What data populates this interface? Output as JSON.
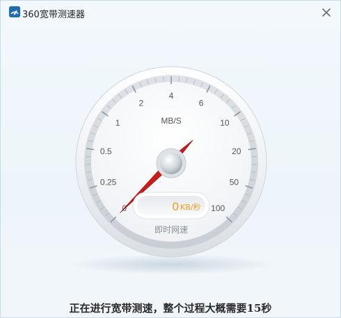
{
  "window": {
    "title": "360宽带测速器",
    "close_icon": "close-icon",
    "app_icon": "360-broadband-speedtest-icon"
  },
  "gauge": {
    "unit_label": "MB/S",
    "scale_labels": [
      "0",
      "0.25",
      "0.5",
      "1",
      "2",
      "4",
      "6",
      "10",
      "20",
      "50",
      "100"
    ],
    "needle_value": 0,
    "speed_value": "0",
    "speed_unit": "KB/秒",
    "caption": "即时网速",
    "needle_color": "#d01818",
    "value_color": "#f29a1c"
  },
  "status": {
    "message": "正在进行宽带测速，整个过程大概需要15秒"
  }
}
